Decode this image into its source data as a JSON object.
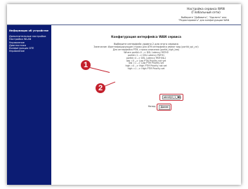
{
  "header": {
    "title": "Настройка сервиса WAN (Глобальный сети)",
    "note": "Выберите \"Добавить\", \"Удалить\" или \"Редактировать\" для конфигурации WAN"
  },
  "sidebar": {
    "heading": "Информация об устройстве",
    "items": [
      {
        "label": "Дополнительные настройки"
      },
      {
        "label": "Настройки WLAN"
      },
      {
        "label": "Управление"
      },
      {
        "label": "Диагностика"
      },
      {
        "label": "Конфигурация DTE"
      },
      {
        "label": "Управление"
      }
    ]
  },
  "main": {
    "title": "Конфигурация интерфейса WAN сервиса",
    "subtitle": "Выберите интерфейс уровня 2 для этого сервиса",
    "description": [
      "Замечание: Идентифицирующие строки для ATM интерфейса имеют вид (portId_vpi_vci)",
      "Для интерфейса PTM, строка описания (portId_high_low)",
      "Where portId=0 --> DSL Latency PATH0",
      "portId=1 --> DSL Latency PATH1",
      "portId=4 --> DSL Latency PATH0&1",
      "low =0 --> Low PTM Priority not set",
      "low =1 --> Low PTM Priority set",
      "high =0 --> High PTM Priority not set",
      "high =1 --> High PTM Priority set"
    ],
    "select_value": "atm0/(0_1_35)",
    "back_label": "Назад",
    "next_label": "Далее"
  },
  "markers": {
    "first": "1",
    "second": "2"
  },
  "colors": {
    "sidebar": "#0c1c73",
    "marker": "#c3202c"
  }
}
